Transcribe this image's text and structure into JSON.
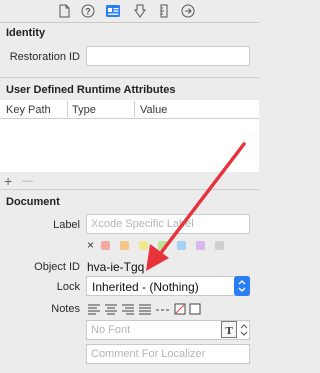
{
  "inspector_tabs": [
    "file-icon",
    "help-icon",
    "identity-icon",
    "attributes-icon",
    "size-icon",
    "connections-icon"
  ],
  "identity": {
    "title": "Identity",
    "restoration_id_label": "Restoration ID",
    "restoration_id_value": ""
  },
  "runtime_attributes": {
    "title": "User Defined Runtime Attributes",
    "columns": [
      "Key Path",
      "Type",
      "Value"
    ],
    "add_label": "+",
    "remove_label": "—"
  },
  "document": {
    "title": "Document",
    "label_label": "Label",
    "label_placeholder": "Xcode Specific Label",
    "clear_label": "×",
    "label_colors": [
      "#f3a9a0",
      "#f5c68a",
      "#f0e88e",
      "#b9e59a",
      "#a8d2f3",
      "#d8b6ee",
      "#cfcfcf"
    ],
    "object_id_label": "Object ID",
    "object_id_value": "hva-ie-Tgq",
    "lock_label": "Lock",
    "lock_value": "Inherited - (Nothing)",
    "notes_label": "Notes",
    "font_placeholder": "No Font",
    "comment_placeholder": "Comment For Localizer"
  },
  "accent_color": "#2a7ef5",
  "annotation_color": "#e8323c"
}
